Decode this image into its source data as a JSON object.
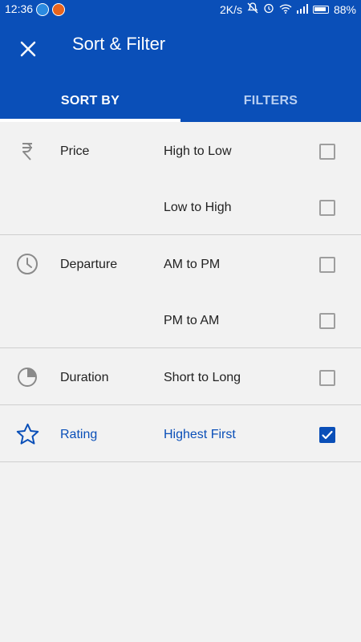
{
  "status_bar": {
    "time": "12:36",
    "network_speed": "2K/s",
    "battery": "88%"
  },
  "header": {
    "title": "Sort & Filter",
    "close_icon": "close-icon"
  },
  "tabs": [
    {
      "label": "SORT BY",
      "active": true
    },
    {
      "label": "FILTERS",
      "active": false
    }
  ],
  "sort_options": [
    {
      "category": "Price",
      "icon": "rupee-icon",
      "options": [
        {
          "label": "High to Low",
          "checked": false
        },
        {
          "label": "Low to High",
          "checked": false
        }
      ]
    },
    {
      "category": "Departure",
      "icon": "clock-icon",
      "options": [
        {
          "label": "AM to PM",
          "checked": false
        },
        {
          "label": "PM to AM",
          "checked": false
        }
      ]
    },
    {
      "category": "Duration",
      "icon": "pie-timer-icon",
      "options": [
        {
          "label": "Short to Long",
          "checked": false
        }
      ]
    },
    {
      "category": "Rating",
      "icon": "star-icon",
      "options": [
        {
          "label": "Highest First",
          "checked": true
        }
      ]
    }
  ],
  "colors": {
    "primary": "#0a4fb8",
    "background": "#f2f2f2",
    "checkbox_border": "#9e9e9e"
  }
}
